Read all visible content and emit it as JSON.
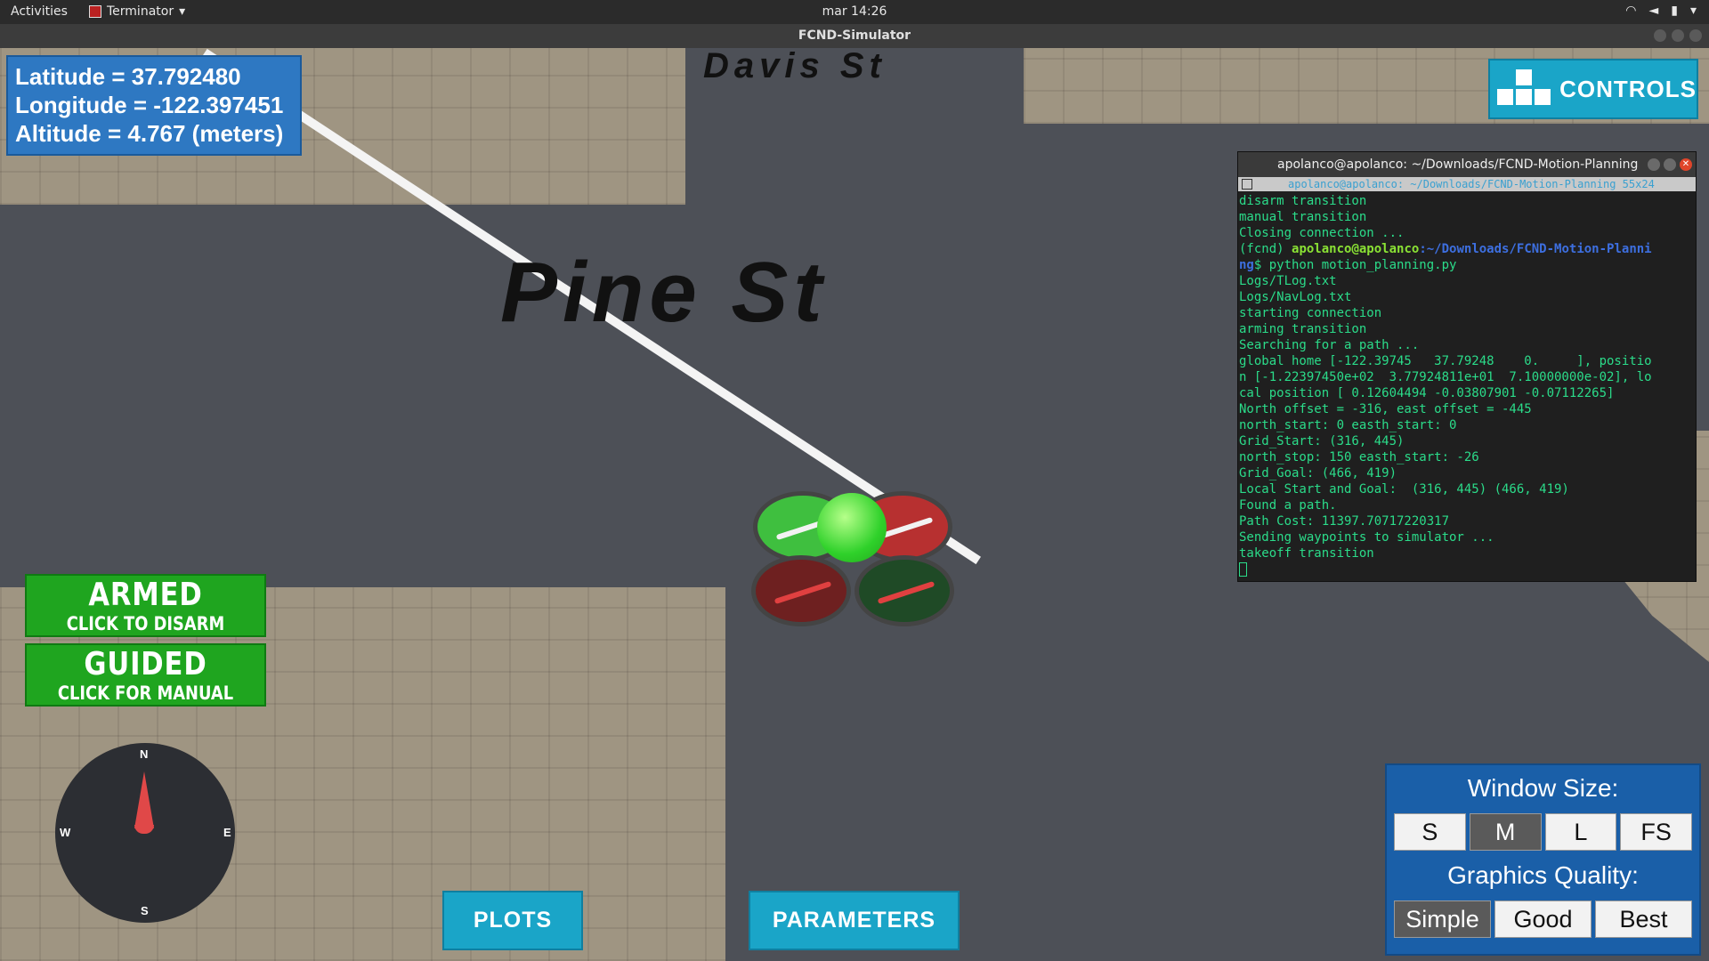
{
  "topbar": {
    "activities": "Activities",
    "app": "Terminator",
    "clock": "mar 14:26"
  },
  "window": {
    "title": "FCND-Simulator"
  },
  "scene": {
    "street_top": "Davis St",
    "street_main": "Pine St"
  },
  "gps": {
    "latitude": "Latitude = 37.792480",
    "longitude": "Longitude = -122.397451",
    "altitude": "Altitude = 4.767 (meters)"
  },
  "controls": {
    "label": "CONTROLS"
  },
  "terminal": {
    "title": "apolanco@apolanco: ~/Downloads/FCND-Motion-Planning",
    "tab": "apolanco@apolanco: ~/Downloads/FCND-Motion-Planning 55x24",
    "lines_before": [
      "disarm transition",
      "manual transition",
      "Closing connection ..."
    ],
    "prompt_prefix": "(fcnd) ",
    "prompt_user": "apolanco@apolanco",
    "prompt_path": ":~/Downloads/FCND-Motion-Planni",
    "prompt_path2": "ng",
    "prompt_cmd": "$ python motion_planning.py",
    "lines_after": [
      "Logs/TLog.txt",
      "Logs/NavLog.txt",
      "starting connection",
      "arming transition",
      "Searching for a path ...",
      "global home [-122.39745   37.79248    0.     ], positio",
      "n [-1.22397450e+02  3.77924811e+01  7.10000000e-02], lo",
      "cal position [ 0.12604494 -0.03807901 -0.07112265]",
      "North offset = -316, east offset = -445",
      "north_start: 0 easth_start: 0",
      "Grid_Start: (316, 445)",
      "north_stop: 150 easth_start: -26",
      "Grid_Goal: (466, 419)",
      "Local Start and Goal:  (316, 445) (466, 419)",
      "Found a path.",
      "Path Cost: 11397.70717220317",
      "Sending waypoints to simulator ...",
      "takeoff transition"
    ]
  },
  "armed": {
    "title": "ARMED",
    "sub": "CLICK TO DISARM"
  },
  "guided": {
    "title": "GUIDED",
    "sub": "CLICK FOR MANUAL"
  },
  "compass": {
    "n": "N",
    "s": "S",
    "e": "E",
    "w": "W"
  },
  "buttons": {
    "plots": "PLOTS",
    "parameters": "PARAMETERS"
  },
  "window_size": {
    "title": "Window Size:",
    "options": [
      "S",
      "M",
      "L",
      "FS"
    ],
    "selected": "M",
    "quality_title": "Graphics Quality:",
    "quality_options": [
      "Simple",
      "Good",
      "Best"
    ],
    "quality_selected": "Simple"
  }
}
